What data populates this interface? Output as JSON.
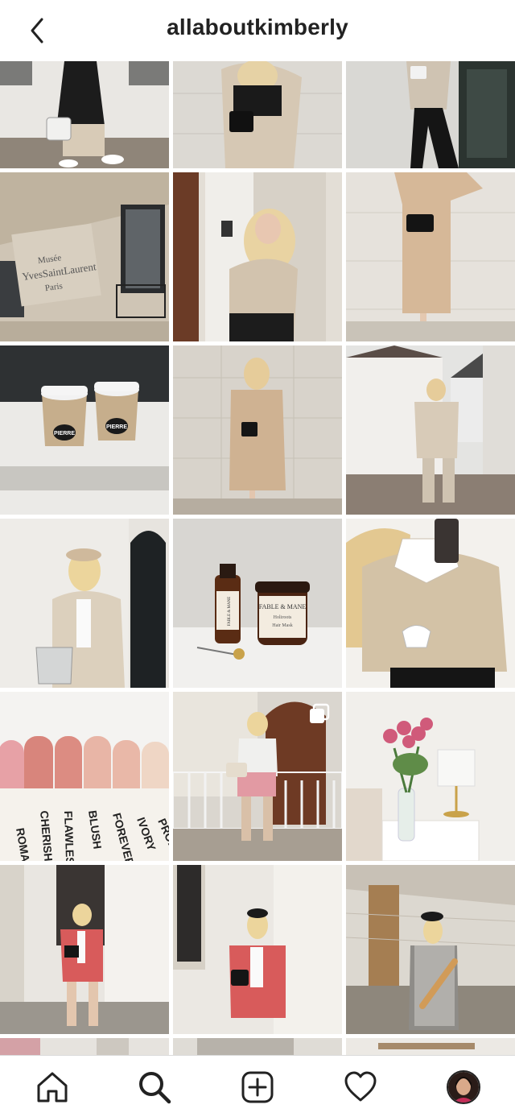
{
  "header": {
    "username": "allaboutkimberly",
    "back_icon": "chevron-left-icon"
  },
  "grid": {
    "tiles": [
      {
        "description_icon": "photo-woman-black-puffer-coat"
      },
      {
        "description_icon": "photo-beige-shirt-black-belt"
      },
      {
        "description_icon": "photo-beige-top-flared-pants"
      },
      {
        "description_icon": "photo-ysl-museum-facade"
      },
      {
        "description_icon": "photo-blonde-beige-sweater"
      },
      {
        "description_icon": "photo-beige-trench-dress"
      },
      {
        "description_icon": "photo-pierre-coffee-cups"
      },
      {
        "description_icon": "photo-beige-trench-dress-wall"
      },
      {
        "description_icon": "photo-beige-blazer-street"
      },
      {
        "description_icon": "photo-cap-beige-blazer"
      },
      {
        "description_icon": "photo-fable-mane-products"
      },
      {
        "description_icon": "photo-cream-cardigan-mirror"
      },
      {
        "description_icon": "photo-nail-polish-swatches"
      },
      {
        "description_icon": "photo-pink-tweed-outfit"
      },
      {
        "description_icon": "photo-pink-roses-lamp"
      },
      {
        "description_icon": "photo-pink-suit-outdoors"
      },
      {
        "description_icon": "photo-pink-blazer-wall"
      },
      {
        "description_icon": "photo-houndstooth-baguette"
      }
    ],
    "cup_label": "PIERRE",
    "museum_sign": [
      "Musée",
      "YvesSaintLaurent",
      "Paris"
    ],
    "product_brand": "FABLE & MANE",
    "product_jar_line1": "FABLE & MANE",
    "product_jar_line2": "Holiroots",
    "product_jar_line3": "Hair Mask",
    "nail_names": [
      "ROMANCE",
      "CHERISH",
      "FLAWLESS",
      "BLUSH",
      "FOREVER",
      "IVORY",
      "PROPO"
    ],
    "multi_post_icon": "carousel-icon"
  },
  "nav": {
    "items": [
      {
        "name": "home",
        "icon": "home-icon"
      },
      {
        "name": "search",
        "icon": "search-icon"
      },
      {
        "name": "new-post",
        "icon": "add-post-icon"
      },
      {
        "name": "activity",
        "icon": "heart-icon"
      },
      {
        "name": "profile",
        "icon": "avatar-icon"
      }
    ]
  },
  "colors": {
    "text": "#222222",
    "background": "#ffffff",
    "border": "#dbdbdb"
  }
}
